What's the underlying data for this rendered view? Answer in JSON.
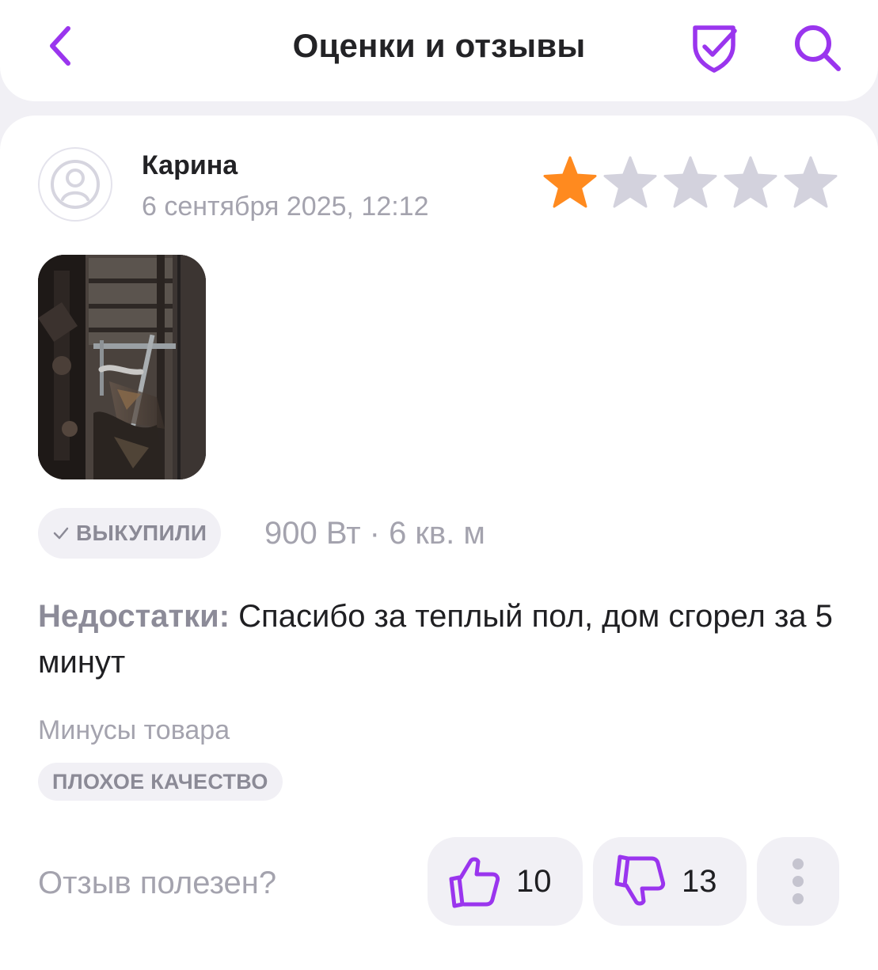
{
  "header": {
    "title": "Оценки и отзывы",
    "back_icon": "chevron-left-icon",
    "shield_icon": "shield-check-icon",
    "search_icon": "search-icon",
    "accent_color": "#9a35ee"
  },
  "review": {
    "author": "Карина",
    "date": "6 сентября 2025, 12:12",
    "rating": 1,
    "rating_max": 5,
    "star_active_color": "#ff8a1f",
    "star_inactive_color": "#d3d2dd",
    "badge_label": "ВЫКУПИЛИ",
    "variant": "900 Вт · 6 кв. м",
    "cons_label": "Недостатки:",
    "cons_text": " Спасибо за теплый пол, дом сгорел за 5 минут",
    "minus_title": "Минусы товара",
    "minus_tag": "ПЛОХОЕ КАЧЕСТВО"
  },
  "feedback": {
    "question": "Отзыв полезен?",
    "likes": "10",
    "dislikes": "13"
  }
}
